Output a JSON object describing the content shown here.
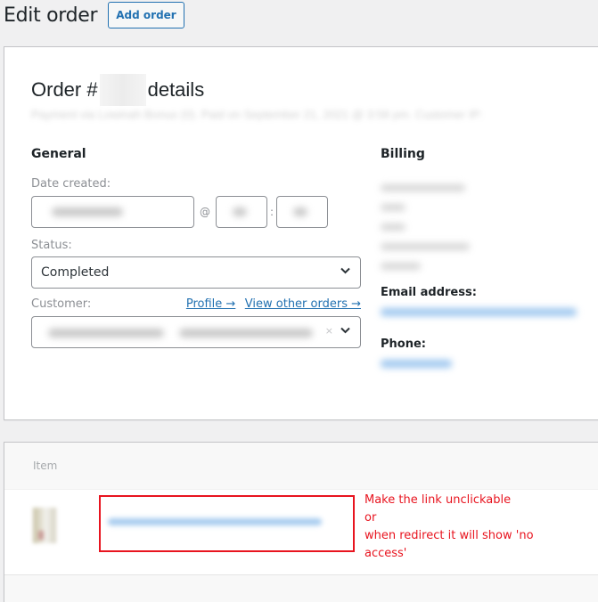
{
  "header": {
    "title": "Edit order",
    "add_order_label": "Add order"
  },
  "order": {
    "heading_prefix": "Order #",
    "heading_suffix": "details",
    "meta_text": "Payment via Lowinah Bonus (0). Paid on September 21, 2021 @ 3:58 pm. Customer IP:",
    "general": {
      "title": "General",
      "date_created_label": "Date created:",
      "time_separator_at": "@",
      "time_separator_colon": ":",
      "status_label": "Status:",
      "status_value": "Completed",
      "customer_label": "Customer:",
      "profile_link": "Profile →",
      "view_orders_link": "View other orders →",
      "customer_clear_glyph": "×"
    },
    "billing": {
      "title": "Billing",
      "email_label": "Email address:",
      "phone_label": "Phone:"
    }
  },
  "items": {
    "column_item": "Item",
    "annotation_lines": [
      "Make the link unclickable",
      "or",
      "when redirect it will show 'no access'"
    ]
  },
  "colors": {
    "accent": "#2271b1",
    "annotation": "#e8141f",
    "background": "#f0f0f1"
  }
}
